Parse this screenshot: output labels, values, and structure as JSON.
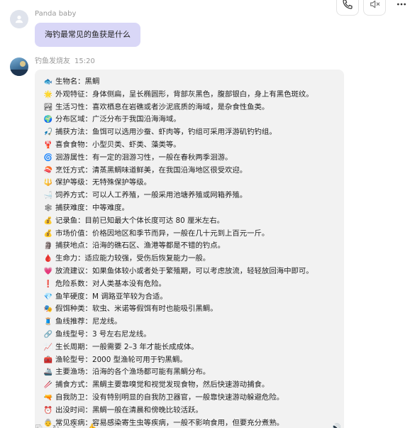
{
  "user": {
    "name": "Panda baby",
    "message": "海钓最常见的鱼获是什么"
  },
  "bot": {
    "name": "钓鱼发烧友",
    "time": "15:20",
    "lines": [
      {
        "icon": "🐟",
        "text": "生物名：黑鲷"
      },
      {
        "icon": "🌟",
        "text": "外观特征：身体侧扁，呈长椭圆形，背部灰黑色，腹部银白，身上有黑色斑纹。"
      },
      {
        "icon": "🏞",
        "text": "生活习性：喜欢栖息在岩礁或者沙泥底质的海域，是杂食性鱼类。"
      },
      {
        "icon": "🌍",
        "text": "分布区域：广泛分布于我国沿海海域。"
      },
      {
        "icon": "🎣",
        "text": "捕获方法：鱼饵可以选用沙蚕、虾肉等，钓组可采用浮游矶钓钓组。"
      },
      {
        "icon": "🦞",
        "text": "喜食食物：小型贝类、虾类、藻类等。"
      },
      {
        "icon": "🌀",
        "text": "洄游属性：有一定的洄游习性，一般在春秋两季洄游。"
      },
      {
        "icon": "🍣",
        "text": "烹饪方式：清蒸黑鲷味道鲜美，在我国沿海地区很受欢迎。"
      },
      {
        "icon": "🔱",
        "text": "保护等级：无特殊保护等级。"
      },
      {
        "icon": "🛁",
        "text": "饲养方式：可以人工养殖，一般采用池塘养殖或网箱养殖。"
      },
      {
        "icon": "🕸",
        "text": "捕获难度：中等难度。"
      },
      {
        "icon": "💰",
        "text": "记录鱼：目前已知最大个体长度可达 80 厘米左右。"
      },
      {
        "icon": "💰",
        "text": "市场价值：价格因地区和季节而异，一般在几十元到上百元一斤。"
      },
      {
        "icon": "🗿",
        "text": "捕获地点：沿海的礁石区、渔港等都是不错的钓点。"
      },
      {
        "icon": "🩸",
        "text": "生命力：适应能力较强，受伤后恢复能力一般。"
      },
      {
        "icon": "💗",
        "text": "放流建议：如果鱼体较小或者处于繁殖期，可以考虑放流，轻轻放回海中即可。"
      },
      {
        "icon": "❗",
        "text": "危险系数：对人类基本没有危险。"
      },
      {
        "icon": "💎",
        "text": "鱼竿硬度：M 调路亚竿较为合适。"
      },
      {
        "icon": "🎭",
        "text": "假饵种类：软虫、米诺等假饵有时也能吸引黑鲷。"
      },
      {
        "icon": "🧵",
        "text": "鱼线推荐：尼龙线。"
      },
      {
        "icon": "🔗",
        "text": "鱼线型号：3 号左右尼龙线。"
      },
      {
        "icon": "📈",
        "text": "生长周期：一般需要 2–3 年才能长成成体。"
      },
      {
        "icon": "🧰",
        "text": "渔轮型号：2000 型渔轮可用于钓黑鲷。"
      },
      {
        "icon": "🚢",
        "text": "主要渔场：沿海的各个渔场都可能有黑鲷分布。"
      },
      {
        "icon": "🥢",
        "text": "捕食方式：黑鲷主要靠嗅觉和视觉发现食物，然后快速游动捕食。"
      },
      {
        "icon": "🔫",
        "text": "自我防卫：没有特别明显的自我防卫器官，一般靠快速游动躲避危险。"
      },
      {
        "icon": "⏰",
        "text": "出没时间：黑鲷一般在清晨和傍晚比较活跃。"
      },
      {
        "icon": "👵",
        "text": "常见疾病：容易感染寄生虫等疾病，一般不影响食用，但要充分煮熟。"
      }
    ]
  },
  "icons": {
    "call": "phone-icon",
    "mute": "mute-icon",
    "more": "more-icon"
  }
}
